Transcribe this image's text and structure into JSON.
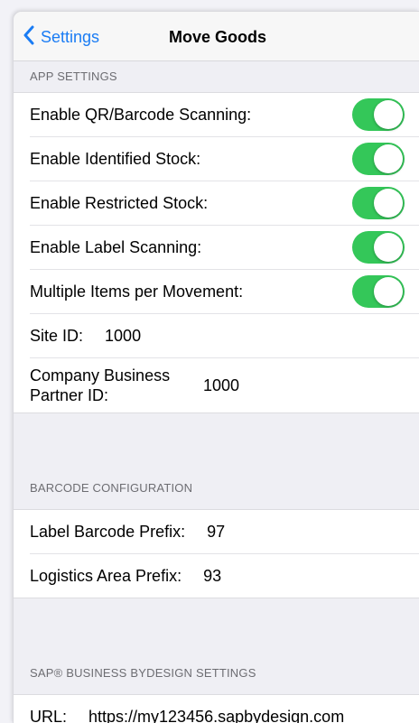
{
  "nav": {
    "back_label": "Settings",
    "title": "Move Goods"
  },
  "app_settings": {
    "header": "APP SETTINGS",
    "toggles": [
      {
        "label": "Enable QR/Barcode Scanning:",
        "on": true
      },
      {
        "label": "Enable Identified Stock:",
        "on": true
      },
      {
        "label": "Enable Restricted Stock:",
        "on": true
      },
      {
        "label": "Enable Label Scanning:",
        "on": true
      },
      {
        "label": "Multiple Items per Movement:",
        "on": true
      }
    ],
    "site_id_label": "Site ID:",
    "site_id_value": "1000",
    "company_bp_label": "Company Business Partner ID:",
    "company_bp_value": "1000"
  },
  "barcode_config": {
    "header": "BARCODE CONFIGURATION",
    "label_prefix_label": "Label Barcode Prefix:",
    "label_prefix_value": "97",
    "logistics_prefix_label": "Logistics Area Prefix:",
    "logistics_prefix_value": "93"
  },
  "sap_settings": {
    "header": "SAP® BUSINESS BYDESIGN SETTINGS",
    "url_label": "URL:",
    "url_value": "https://my123456.sapbydesign.com"
  },
  "colors": {
    "accent": "#1a7cf4",
    "toggle_on": "#34c759"
  }
}
